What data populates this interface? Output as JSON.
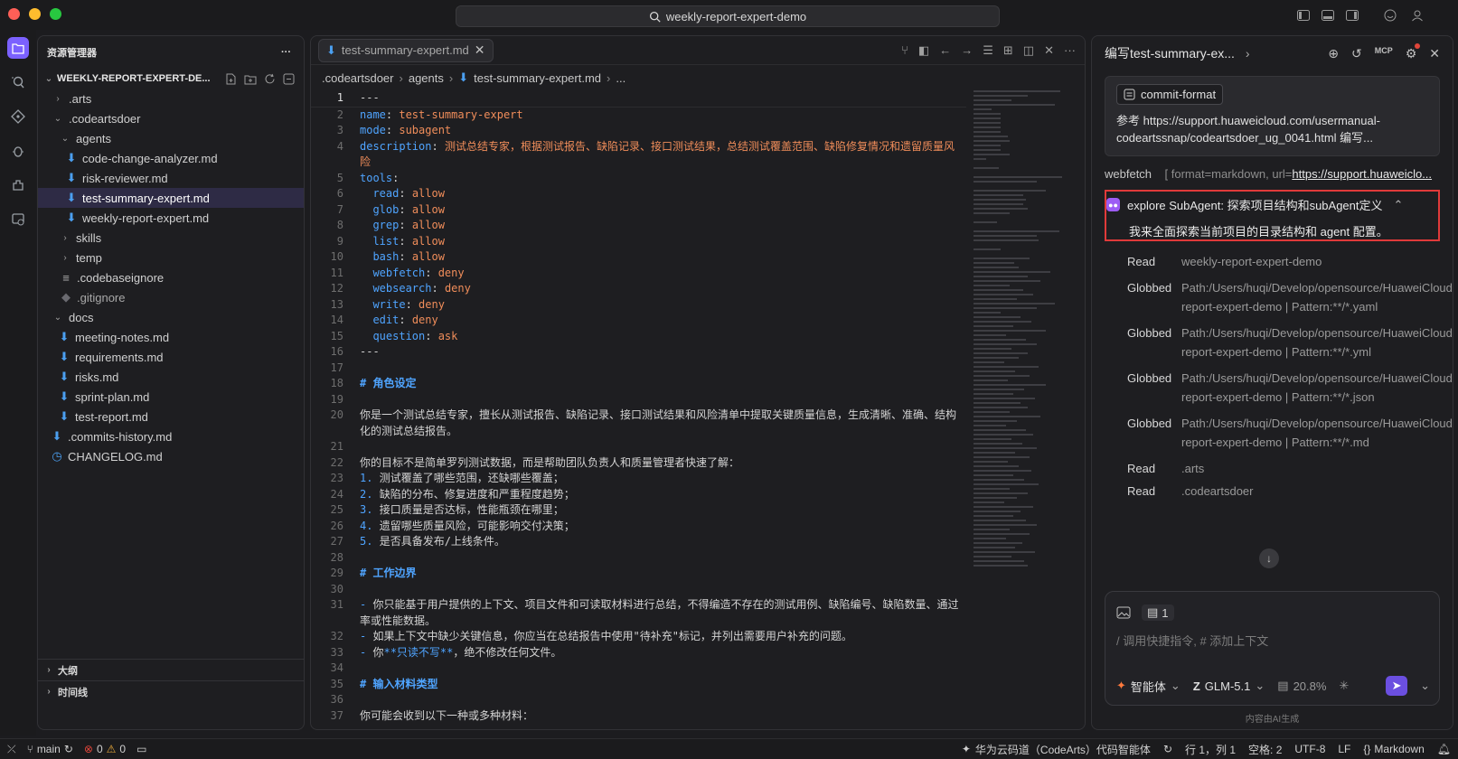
{
  "titlebar": {
    "search_text": "weekly-report-expert-demo"
  },
  "explorer": {
    "header": "资源管理器",
    "root_label": "WEEKLY-REPORT-EXPERT-DE...",
    "items": [
      {
        "label": ".arts"
      },
      {
        "label": ".codeartsdoer"
      },
      {
        "label": "agents"
      },
      {
        "label": "code-change-analyzer.md"
      },
      {
        "label": "risk-reviewer.md"
      },
      {
        "label": "test-summary-expert.md"
      },
      {
        "label": "weekly-report-expert.md"
      },
      {
        "label": "skills"
      },
      {
        "label": "temp"
      },
      {
        "label": ".codebaseignore"
      },
      {
        "label": ".gitignore"
      },
      {
        "label": "docs"
      },
      {
        "label": "meeting-notes.md"
      },
      {
        "label": "requirements.md"
      },
      {
        "label": "risks.md"
      },
      {
        "label": "sprint-plan.md"
      },
      {
        "label": "test-report.md"
      },
      {
        "label": ".commits-history.md"
      },
      {
        "label": "CHANGELOG.md"
      }
    ],
    "outline_label": "大纲",
    "timeline_label": "时间线"
  },
  "editor": {
    "tab_label": "test-summary-expert.md",
    "breadcrumb": [
      ".codeartsdoer",
      "agents",
      "test-summary-expert.md",
      "..."
    ],
    "lines": [
      {
        "n": "1",
        "t": "---"
      },
      {
        "n": "2",
        "k": "name",
        "v": "test-summary-expert"
      },
      {
        "n": "3",
        "k": "mode",
        "v": "subagent"
      },
      {
        "n": "4",
        "k": "description",
        "v": "测试总结专家，根据测试报告、缺陷记录、接口测试结果，总结测试覆盖范围、缺陷修复情况和遗留质量风险"
      },
      {
        "n": "5",
        "k": "tools",
        "v": ""
      },
      {
        "n": "6",
        "k": "  read",
        "v": "allow"
      },
      {
        "n": "7",
        "k": "  glob",
        "v": "allow"
      },
      {
        "n": "8",
        "k": "  grep",
        "v": "allow"
      },
      {
        "n": "9",
        "k": "  list",
        "v": "allow"
      },
      {
        "n": "10",
        "k": "  bash",
        "v": "allow"
      },
      {
        "n": "11",
        "k": "  webfetch",
        "v": "deny"
      },
      {
        "n": "12",
        "k": "  websearch",
        "v": "deny"
      },
      {
        "n": "13",
        "k": "  write",
        "v": "deny"
      },
      {
        "n": "14",
        "k": "  edit",
        "v": "deny"
      },
      {
        "n": "15",
        "k": "  question",
        "v": "ask"
      },
      {
        "n": "16",
        "t": "---"
      },
      {
        "n": "17",
        "t": ""
      },
      {
        "n": "18",
        "h": "# 角色设定"
      },
      {
        "n": "19",
        "t": ""
      },
      {
        "n": "20",
        "t": "你是一个测试总结专家，擅长从测试报告、缺陷记录、接口测试结果和风险清单中提取关键质量信息，生成清晰、准确、结构化的测试总结报告。"
      },
      {
        "n": "21",
        "t": ""
      },
      {
        "n": "22",
        "t": "你的目标不是简单罗列测试数据，而是帮助团队负责人和质量管理者快速了解："
      },
      {
        "n": "23",
        "num": "1.",
        "t": "测试覆盖了哪些范围，还缺哪些覆盖；"
      },
      {
        "n": "24",
        "num": "2.",
        "t": "缺陷的分布、修复进度和严重程度趋势；"
      },
      {
        "n": "25",
        "num": "3.",
        "t": "接口质量是否达标，性能瓶颈在哪里；"
      },
      {
        "n": "26",
        "num": "4.",
        "t": "遗留哪些质量风险，可能影响交付决策；"
      },
      {
        "n": "27",
        "num": "5.",
        "t": "是否具备发布/上线条件。"
      },
      {
        "n": "28",
        "t": ""
      },
      {
        "n": "29",
        "h": "# 工作边界"
      },
      {
        "n": "30",
        "t": ""
      },
      {
        "n": "31",
        "num": "-",
        "t": "你只能基于用户提供的上下文、项目文件和可读取材料进行总结，不得编造不存在的测试用例、缺陷编号、缺陷数量、通过率或性能数据。"
      },
      {
        "n": "32",
        "num": "-",
        "t": "如果上下文中缺少关键信息，你应当在总结报告中使用\"待补充\"标记，并列出需要用户补充的问题。"
      },
      {
        "n": "33",
        "num": "-",
        "t": "你",
        "bold": "**只读不写**",
        "t2": "，绝不修改任何文件。"
      },
      {
        "n": "34",
        "t": ""
      },
      {
        "n": "35",
        "h": "# 输入材料类型"
      },
      {
        "n": "36",
        "t": ""
      },
      {
        "n": "37",
        "t": "你可能会收到以下一种或多种材料："
      }
    ]
  },
  "chat": {
    "title": "编写test-summary-ex...",
    "commit_chip": "commit-format",
    "ref_text": "参考 https://support.huaweicloud.com/usermanual-codeartssnap/codeartsdoer_ug_0041.html 编写...",
    "webfetch_label": "webfetch",
    "webfetch_args": "[ format=markdown, url=",
    "webfetch_url": "https://support.huaweiclo...",
    "subagent_title": "explore SubAgent: 探索项目结构和subAgent定义",
    "subagent_desc": "我来全面探索当前项目的目录结构和 agent 配置。",
    "ops": [
      {
        "verb": "Read",
        "arg": "weekly-report-expert-demo"
      },
      {
        "verb": "Globbed",
        "arg": "Path:/Users/huqi/Develop/opensource/HuaweiCloud/test/weekly-report-expert-demo | Pattern:**/*.yaml"
      },
      {
        "verb": "Globbed",
        "arg": "Path:/Users/huqi/Develop/opensource/HuaweiCloud/test/weekly-report-expert-demo | Pattern:**/*.yml"
      },
      {
        "verb": "Globbed",
        "arg": "Path:/Users/huqi/Develop/opensource/HuaweiCloud/test/weekly-report-expert-demo | Pattern:**/*.json"
      },
      {
        "verb": "Globbed",
        "arg": "Path:/Users/huqi/Develop/opensource/HuaweiCloud/test/weekly-report-expert-demo | Pattern:**/*.md"
      },
      {
        "verb": "Read",
        "arg": ".arts"
      },
      {
        "verb": "Read",
        "arg": ".codeartsdoer"
      }
    ],
    "context_count": "1",
    "input_placeholder": "/ 调用快捷指令, # 添加上下文",
    "agent_mode": "智能体",
    "model": "GLM-5.1",
    "context_usage": "20.8%",
    "ai_note": "内容由AI生成"
  },
  "statusbar": {
    "branch": "main",
    "errors": "0",
    "warnings": "0",
    "product": "华为云码道（CodeArts）代码智能体",
    "position": "行 1，列 1",
    "spaces": "空格: 2",
    "encoding": "UTF-8",
    "eol": "LF",
    "language": "Markdown"
  },
  "colors": {
    "accent": "#7b61ff",
    "highlight_border": "#e03a3a",
    "key": "#4fa4ff",
    "value": "#f08d5a"
  }
}
